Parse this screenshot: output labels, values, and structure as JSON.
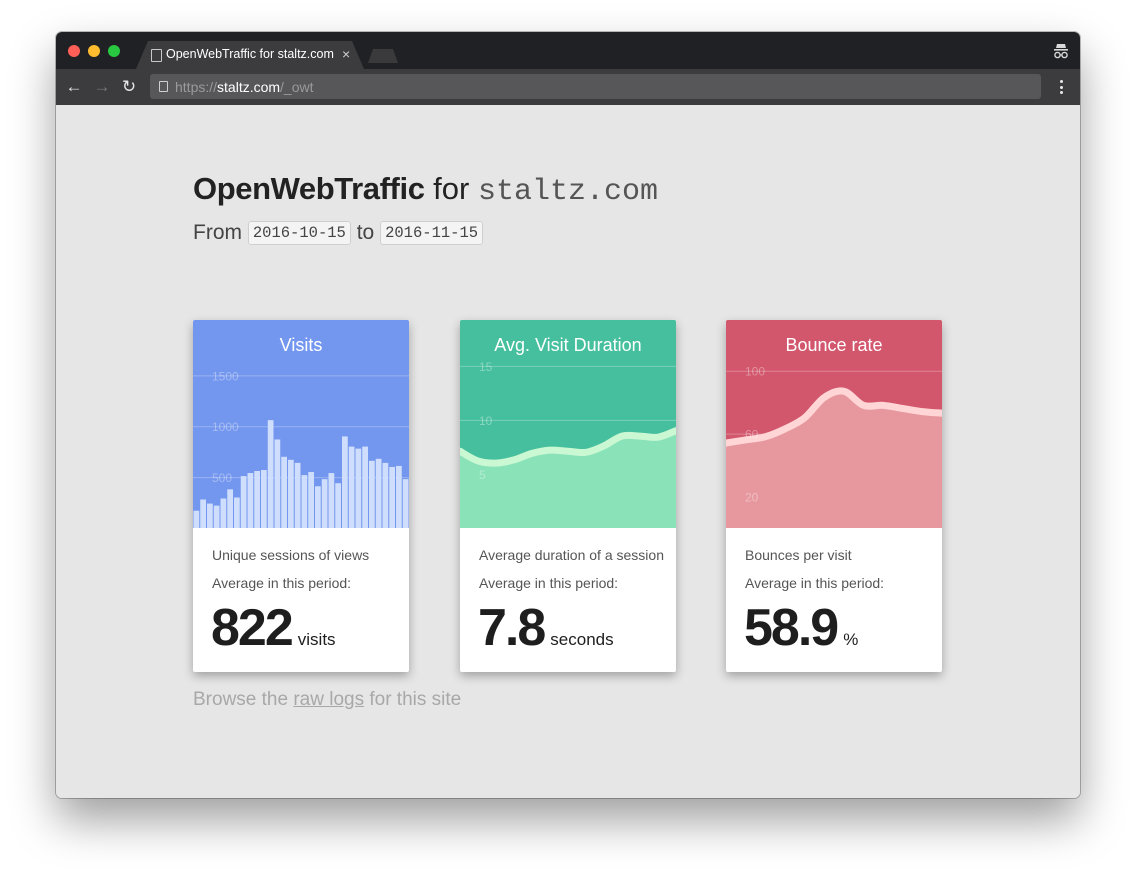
{
  "browser": {
    "tab_title": "OpenWebTraffic for staltz.com",
    "tab_close": "×",
    "url_scheme": "https://",
    "url_host": "staltz.com",
    "url_path": "/_owt",
    "traffic_lights": [
      "#ff5f57",
      "#febc2e",
      "#28c840"
    ]
  },
  "page": {
    "title_bold": "OpenWebTraffic",
    "title_for": "for",
    "title_domain": "staltz.com",
    "from_label": "From",
    "from_date": "2016-10-15",
    "to_label": "to",
    "to_date": "2016-11-15",
    "raw_before": "Browse the",
    "raw_link": "raw logs",
    "raw_after": "for this site"
  },
  "cards": [
    {
      "title": "Visits",
      "description": "Unique sessions of views",
      "avg_label": "Average in this period:",
      "value": "822",
      "unit": "visits",
      "color": "#7396ee",
      "fill": "#cfdefc",
      "line": null
    },
    {
      "title": "Avg. Visit Duration",
      "description": "Average duration of a session",
      "avg_label": "Average in this period:",
      "value": "7.8",
      "unit": "seconds",
      "color": "#45bf9d",
      "fill": "#8ae2b9",
      "line": "#c9f8d3"
    },
    {
      "title": "Bounce rate",
      "description": "Bounces per visit",
      "avg_label": "Average in this period:",
      "value": "58.9",
      "unit": "%",
      "color": "#d2566c",
      "fill": "#e6989e",
      "line": "#ffd5d5"
    }
  ],
  "chart_data": [
    {
      "type": "bar",
      "title": "Visits",
      "ylim": [
        0,
        1700
      ],
      "ticks": [
        500,
        1000,
        1500
      ],
      "grid": true,
      "values": [
        170,
        280,
        240,
        220,
        290,
        380,
        300,
        510,
        540,
        560,
        570,
        1060,
        870,
        700,
        670,
        640,
        520,
        550,
        410,
        480,
        540,
        440,
        900,
        800,
        780,
        800,
        660,
        680,
        640,
        600,
        610,
        480
      ]
    },
    {
      "type": "area",
      "title": "Avg. Visit Duration",
      "ylim": [
        0,
        16
      ],
      "ticks": [
        5,
        10,
        15
      ],
      "grid": true,
      "values": [
        7.1,
        6.2,
        6.0,
        6.3,
        6.9,
        7.2,
        7.1,
        7.0,
        7.6,
        8.5,
        8.5,
        8.4,
        9.0
      ]
    },
    {
      "type": "area",
      "title": "Bounce rate",
      "ylim": [
        0,
        110
      ],
      "ticks": [
        20,
        60,
        100
      ],
      "grid": true,
      "values": [
        54,
        56,
        58,
        63,
        70,
        83,
        87,
        78,
        78,
        76,
        74,
        73
      ]
    }
  ]
}
